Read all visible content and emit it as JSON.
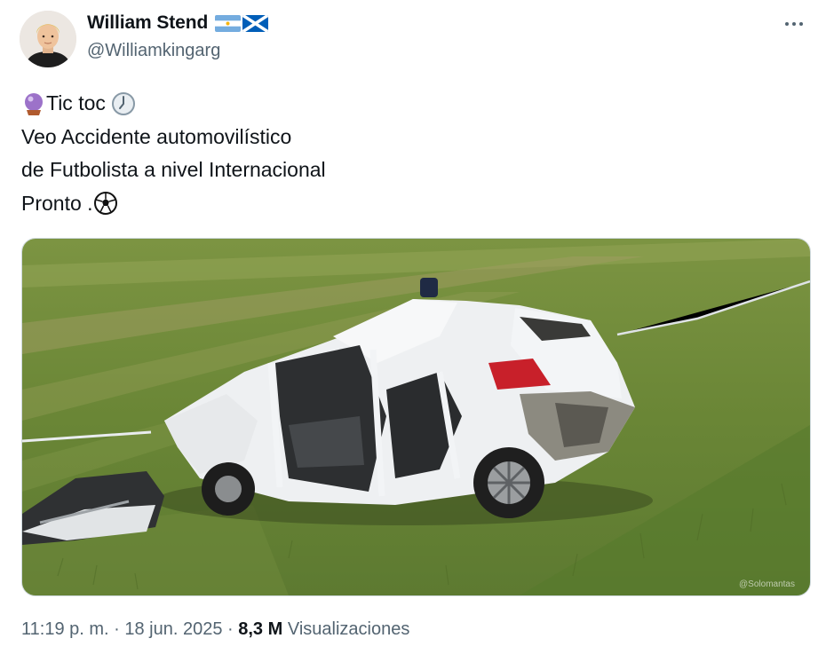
{
  "author": {
    "display_name": "William Stend",
    "handle": "@Williamkingarg",
    "flags": [
      "argentina-flag-icon",
      "scotland-flag-icon"
    ]
  },
  "tweet": {
    "lines": [
      {
        "text": "Tic toc ",
        "leading_icon": "crystal-ball-icon",
        "trailing_icon": "clock-icon"
      },
      {
        "text": "Veo Accidente automovilístico"
      },
      {
        "text": "de Futbolista a nivel Internacional"
      },
      {
        "text": "Pronto .",
        "trailing_icon": "soccer-ball-icon"
      }
    ]
  },
  "media": {
    "icon": "photo-crashed-car-in-grass",
    "watermark": "@Solomantas"
  },
  "meta": {
    "time": "11:19 p. m.",
    "separator": " · ",
    "date": "18 jun. 2025",
    "views_count": "8,3 M",
    "views_label": " Visualizaciones"
  },
  "colors": {
    "text": "#0f1419",
    "secondary": "#536471",
    "border": "#cfd9de",
    "grass": "#6d8a3a"
  }
}
